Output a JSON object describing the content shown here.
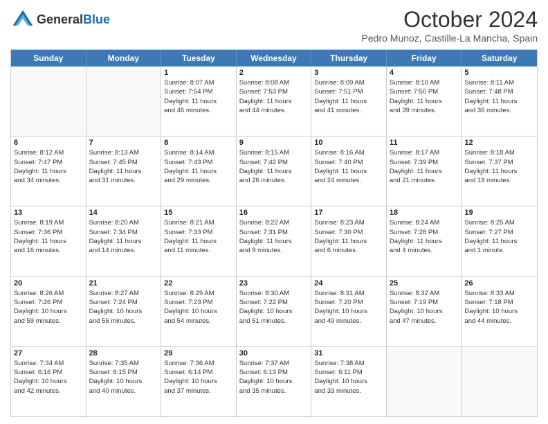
{
  "header": {
    "logo_general": "General",
    "logo_blue": "Blue",
    "month_title": "October 2024",
    "subtitle": "Pedro Munoz, Castille-La Mancha, Spain"
  },
  "weekdays": [
    "Sunday",
    "Monday",
    "Tuesday",
    "Wednesday",
    "Thursday",
    "Friday",
    "Saturday"
  ],
  "rows": [
    [
      {
        "day": "",
        "empty": true,
        "lines": []
      },
      {
        "day": "",
        "empty": true,
        "lines": []
      },
      {
        "day": "1",
        "empty": false,
        "lines": [
          "Sunrise: 8:07 AM",
          "Sunset: 7:54 PM",
          "Daylight: 11 hours",
          "and 46 minutes."
        ]
      },
      {
        "day": "2",
        "empty": false,
        "lines": [
          "Sunrise: 8:08 AM",
          "Sunset: 7:53 PM",
          "Daylight: 11 hours",
          "and 44 minutes."
        ]
      },
      {
        "day": "3",
        "empty": false,
        "lines": [
          "Sunrise: 8:09 AM",
          "Sunset: 7:51 PM",
          "Daylight: 11 hours",
          "and 41 minutes."
        ]
      },
      {
        "day": "4",
        "empty": false,
        "lines": [
          "Sunrise: 8:10 AM",
          "Sunset: 7:50 PM",
          "Daylight: 11 hours",
          "and 39 minutes."
        ]
      },
      {
        "day": "5",
        "empty": false,
        "lines": [
          "Sunrise: 8:11 AM",
          "Sunset: 7:48 PM",
          "Daylight: 11 hours",
          "and 36 minutes."
        ]
      }
    ],
    [
      {
        "day": "6",
        "empty": false,
        "lines": [
          "Sunrise: 8:12 AM",
          "Sunset: 7:47 PM",
          "Daylight: 11 hours",
          "and 34 minutes."
        ]
      },
      {
        "day": "7",
        "empty": false,
        "lines": [
          "Sunrise: 8:13 AM",
          "Sunset: 7:45 PM",
          "Daylight: 11 hours",
          "and 31 minutes."
        ]
      },
      {
        "day": "8",
        "empty": false,
        "lines": [
          "Sunrise: 8:14 AM",
          "Sunset: 7:43 PM",
          "Daylight: 11 hours",
          "and 29 minutes."
        ]
      },
      {
        "day": "9",
        "empty": false,
        "lines": [
          "Sunrise: 8:15 AM",
          "Sunset: 7:42 PM",
          "Daylight: 11 hours",
          "and 26 minutes."
        ]
      },
      {
        "day": "10",
        "empty": false,
        "lines": [
          "Sunrise: 8:16 AM",
          "Sunset: 7:40 PM",
          "Daylight: 11 hours",
          "and 24 minutes."
        ]
      },
      {
        "day": "11",
        "empty": false,
        "lines": [
          "Sunrise: 8:17 AM",
          "Sunset: 7:39 PM",
          "Daylight: 11 hours",
          "and 21 minutes."
        ]
      },
      {
        "day": "12",
        "empty": false,
        "lines": [
          "Sunrise: 8:18 AM",
          "Sunset: 7:37 PM",
          "Daylight: 11 hours",
          "and 19 minutes."
        ]
      }
    ],
    [
      {
        "day": "13",
        "empty": false,
        "lines": [
          "Sunrise: 8:19 AM",
          "Sunset: 7:36 PM",
          "Daylight: 11 hours",
          "and 16 minutes."
        ]
      },
      {
        "day": "14",
        "empty": false,
        "lines": [
          "Sunrise: 8:20 AM",
          "Sunset: 7:34 PM",
          "Daylight: 11 hours",
          "and 14 minutes."
        ]
      },
      {
        "day": "15",
        "empty": false,
        "lines": [
          "Sunrise: 8:21 AM",
          "Sunset: 7:33 PM",
          "Daylight: 11 hours",
          "and 11 minutes."
        ]
      },
      {
        "day": "16",
        "empty": false,
        "lines": [
          "Sunrise: 8:22 AM",
          "Sunset: 7:31 PM",
          "Daylight: 11 hours",
          "and 9 minutes."
        ]
      },
      {
        "day": "17",
        "empty": false,
        "lines": [
          "Sunrise: 8:23 AM",
          "Sunset: 7:30 PM",
          "Daylight: 11 hours",
          "and 6 minutes."
        ]
      },
      {
        "day": "18",
        "empty": false,
        "lines": [
          "Sunrise: 8:24 AM",
          "Sunset: 7:28 PM",
          "Daylight: 11 hours",
          "and 4 minutes."
        ]
      },
      {
        "day": "19",
        "empty": false,
        "lines": [
          "Sunrise: 8:25 AM",
          "Sunset: 7:27 PM",
          "Daylight: 11 hours",
          "and 1 minute."
        ]
      }
    ],
    [
      {
        "day": "20",
        "empty": false,
        "lines": [
          "Sunrise: 8:26 AM",
          "Sunset: 7:26 PM",
          "Daylight: 10 hours",
          "and 59 minutes."
        ]
      },
      {
        "day": "21",
        "empty": false,
        "lines": [
          "Sunrise: 8:27 AM",
          "Sunset: 7:24 PM",
          "Daylight: 10 hours",
          "and 56 minutes."
        ]
      },
      {
        "day": "22",
        "empty": false,
        "lines": [
          "Sunrise: 8:29 AM",
          "Sunset: 7:23 PM",
          "Daylight: 10 hours",
          "and 54 minutes."
        ]
      },
      {
        "day": "23",
        "empty": false,
        "lines": [
          "Sunrise: 8:30 AM",
          "Sunset: 7:22 PM",
          "Daylight: 10 hours",
          "and 51 minutes."
        ]
      },
      {
        "day": "24",
        "empty": false,
        "lines": [
          "Sunrise: 8:31 AM",
          "Sunset: 7:20 PM",
          "Daylight: 10 hours",
          "and 49 minutes."
        ]
      },
      {
        "day": "25",
        "empty": false,
        "lines": [
          "Sunrise: 8:32 AM",
          "Sunset: 7:19 PM",
          "Daylight: 10 hours",
          "and 47 minutes."
        ]
      },
      {
        "day": "26",
        "empty": false,
        "lines": [
          "Sunrise: 8:33 AM",
          "Sunset: 7:18 PM",
          "Daylight: 10 hours",
          "and 44 minutes."
        ]
      }
    ],
    [
      {
        "day": "27",
        "empty": false,
        "lines": [
          "Sunrise: 7:34 AM",
          "Sunset: 6:16 PM",
          "Daylight: 10 hours",
          "and 42 minutes."
        ]
      },
      {
        "day": "28",
        "empty": false,
        "lines": [
          "Sunrise: 7:35 AM",
          "Sunset: 6:15 PM",
          "Daylight: 10 hours",
          "and 40 minutes."
        ]
      },
      {
        "day": "29",
        "empty": false,
        "lines": [
          "Sunrise: 7:36 AM",
          "Sunset: 6:14 PM",
          "Daylight: 10 hours",
          "and 37 minutes."
        ]
      },
      {
        "day": "30",
        "empty": false,
        "lines": [
          "Sunrise: 7:37 AM",
          "Sunset: 6:13 PM",
          "Daylight: 10 hours",
          "and 35 minutes."
        ]
      },
      {
        "day": "31",
        "empty": false,
        "lines": [
          "Sunrise: 7:38 AM",
          "Sunset: 6:11 PM",
          "Daylight: 10 hours",
          "and 33 minutes."
        ]
      },
      {
        "day": "",
        "empty": true,
        "lines": []
      },
      {
        "day": "",
        "empty": true,
        "lines": []
      }
    ]
  ]
}
